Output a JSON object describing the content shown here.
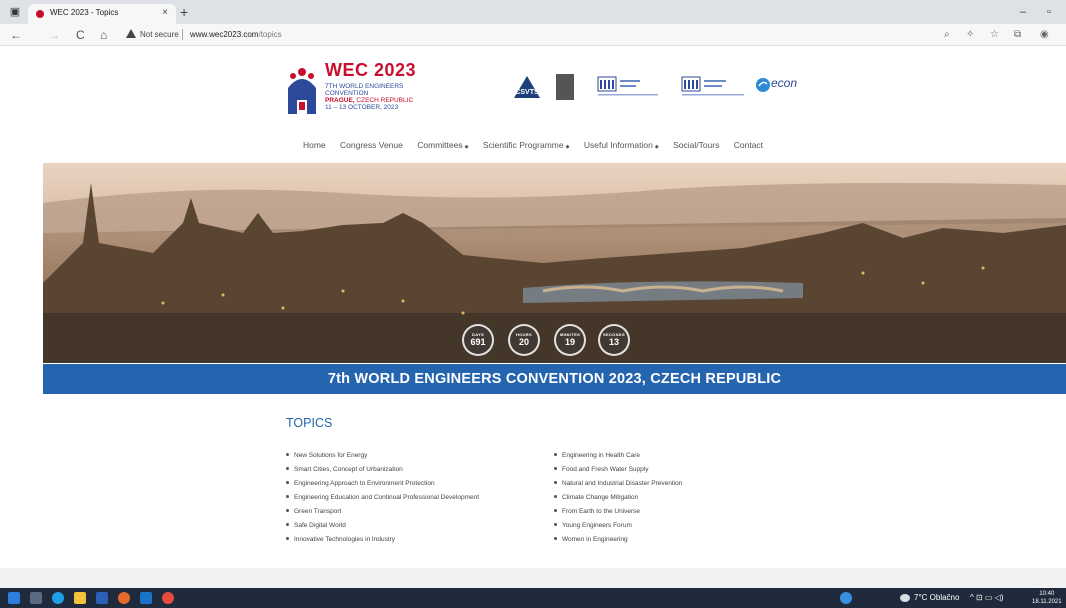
{
  "browser": {
    "tab_title": "WEC 2023 - Topics",
    "tab_close": "×",
    "new_tab": "+",
    "not_secure": "Not secure",
    "url_host": "www.wec2023.com",
    "url_path": "/topics",
    "nav_back": "←",
    "nav_forward": "→",
    "nav_reload": "C",
    "nav_home": "⌂",
    "minimize": "–",
    "restore": "▫"
  },
  "logo": {
    "title": "WEC 2023",
    "line1": "7TH WORLD ENGINEERS",
    "line2": "CONVENTION",
    "line3_city": "PRAGUE,",
    "line3_country": " CZECH REPUBLIC",
    "line4": "11 – 13 OCTOBER, 2023"
  },
  "partners": {
    "econ_label": "econ"
  },
  "nav": {
    "items": [
      {
        "label": "Home",
        "dropdown": false
      },
      {
        "label": "Congress Venue",
        "dropdown": false
      },
      {
        "label": "Committees",
        "dropdown": true
      },
      {
        "label": "Scientific Programme",
        "dropdown": true
      },
      {
        "label": "Useful Information",
        "dropdown": true
      },
      {
        "label": "Social/Tours",
        "dropdown": false
      },
      {
        "label": "Contact",
        "dropdown": false
      }
    ],
    "caret": "◆"
  },
  "countdown": {
    "days_label": "DAYS",
    "days_value": "691",
    "hours_label": "HOURS",
    "hours_value": "20",
    "minutes_label": "MINUTES",
    "minutes_value": "19",
    "seconds_label": "SECONDS",
    "seconds_value": "13"
  },
  "banner": {
    "title": "7th WORLD ENGINEERS CONVENTION 2023, CZECH REPUBLIC"
  },
  "topics": {
    "heading": "TOPICS",
    "left": [
      "New Solutions for Energy",
      "Smart Cities, Concept of Urbanization",
      "Engineering Approach to Environment Protection",
      "Engineering Education and Continual Professional Development",
      "Green Transport",
      "Safe Digital World",
      "Innovative Technologies in Industry"
    ],
    "right": [
      "Engineering in Health Care",
      "Food and Fresh Water Supply",
      "Natural and Industrial Disaster Prevention",
      "Climate Change Mitigation",
      "From Earth to the Universe",
      "Young Engineers Forum",
      "Women in Engineering"
    ]
  },
  "taskbar": {
    "weather": "7°C Oblačno",
    "time": "10:40",
    "date": "18.11.2021"
  }
}
